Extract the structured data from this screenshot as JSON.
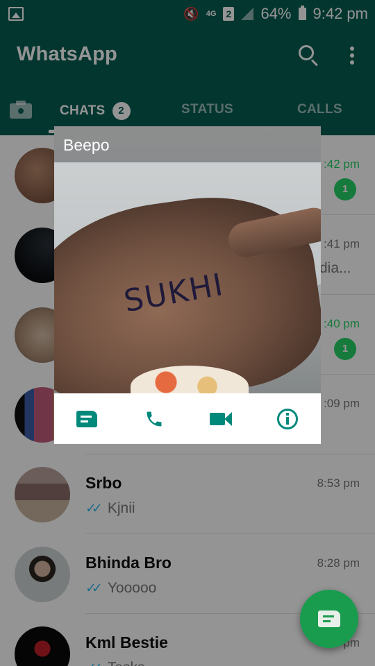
{
  "status_bar": {
    "network": "4G",
    "sim": "2",
    "battery": "64%",
    "time": "9:42 pm"
  },
  "app_bar": {
    "title": "WhatsApp"
  },
  "tabs": {
    "chats": "CHATS",
    "chats_badge": "2",
    "status": "STATUS",
    "calls": "CALLS"
  },
  "chats": [
    {
      "name": "",
      "time": ":42 pm",
      "preview": "",
      "unread": "1"
    },
    {
      "name": "",
      "time": ":41 pm",
      "preview": "dia...",
      "unread": ""
    },
    {
      "name": "",
      "time": ":40 pm",
      "preview": "",
      "unread": "1"
    },
    {
      "name": "",
      "time": ":09 pm",
      "preview": "",
      "unread": ""
    },
    {
      "name": "Srbo",
      "time": "8:53 pm",
      "preview": "Kjnii",
      "unread": ""
    },
    {
      "name": "Bhinda Bro",
      "time": "8:28 pm",
      "preview": "Yooooo",
      "unread": ""
    },
    {
      "name": "Kml Bestie",
      "time": "pm",
      "preview": "Tasks",
      "unread": ""
    }
  ],
  "popup": {
    "contact_name": "Beepo",
    "photo_text": "SUKHI"
  },
  "icons": {
    "message": "message-icon",
    "call": "call-icon",
    "video": "video-call-icon",
    "info": "info-icon",
    "fab": "new-chat-icon"
  },
  "colors": {
    "primary": "#075e54",
    "accent": "#25d366",
    "popup_icon": "#00897b"
  }
}
